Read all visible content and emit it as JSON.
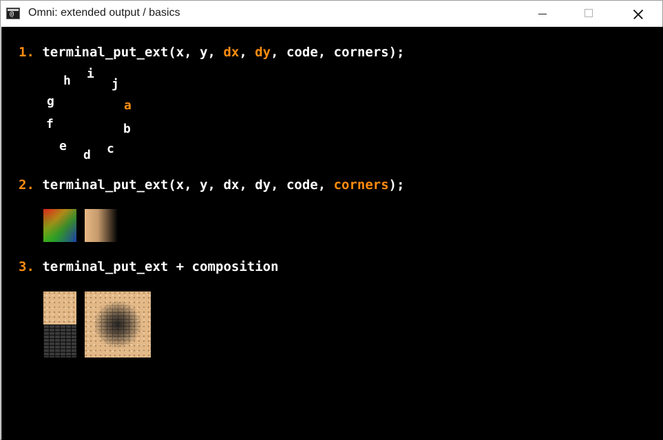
{
  "window": {
    "title": "Omni: extended output / basics",
    "icon": "console-window-icon",
    "icon_glyph": "@"
  },
  "colors": {
    "highlight": "#ff8c10",
    "text": "#ffffff",
    "background": "#000000"
  },
  "sections": [
    {
      "number": "1.",
      "parts": [
        "terminal_put_ext(x, y, ",
        "dx",
        ", ",
        "dy",
        ", code, corners);"
      ],
      "glyphs": [
        "h",
        "i",
        "j",
        "g",
        "a",
        "f",
        "b",
        "e",
        "d",
        "c"
      ]
    },
    {
      "number": "2.",
      "parts": [
        "terminal_put_ext(x, y, dx, dy, code, ",
        "corners",
        ");"
      ]
    },
    {
      "number": "3.",
      "parts": [
        "terminal_put_ext + composition"
      ]
    }
  ]
}
